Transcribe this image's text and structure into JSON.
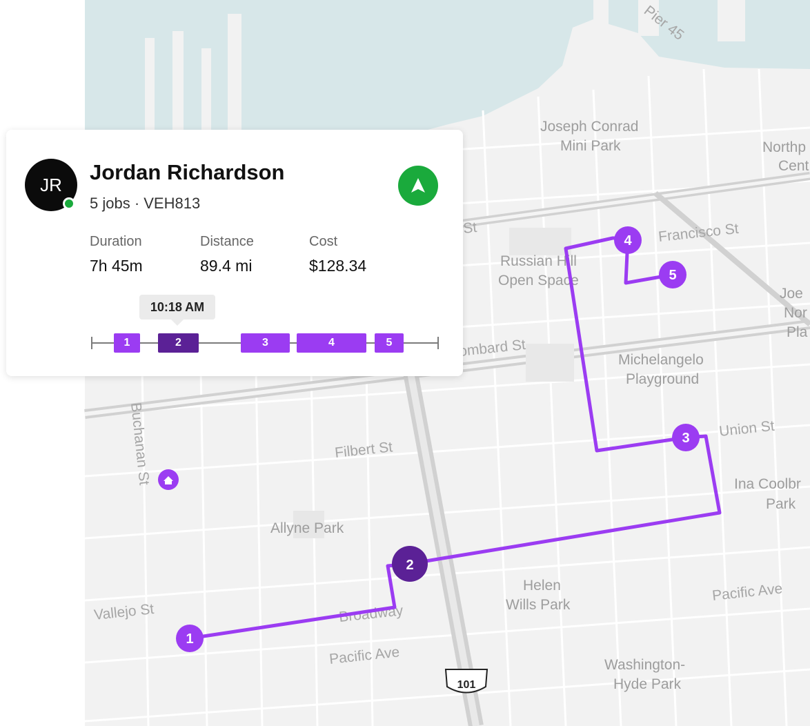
{
  "map": {
    "labels": {
      "pier": "Pier 45",
      "joseph_conrad_1": "Joseph Conrad",
      "joseph_conrad_2": "Mini Park",
      "north_1": "Northp",
      "north_2": "Cent",
      "francisco_st": "Francisco St",
      "st_fragment": "St",
      "russian_hill_1": "Russian Hill",
      "russian_hill_2": "Open Space",
      "joe_1": "Joe",
      "joe_2": "Nor",
      "joe_3": "Pla",
      "lombard_st": "ombard St",
      "michelangelo_1": "Michelangelo",
      "michelangelo_2": "Playground",
      "union_st": "Union St",
      "ina_1": "Ina Coolbr",
      "ina_2": "Park",
      "buchanan_st": "Buchanan St",
      "filbert_st": "Filbert St",
      "allyne_park": "Allyne Park",
      "helen_wills_1": "Helen",
      "helen_wills_2": "Wills Park",
      "pacific_ave_right": "Pacific Ave",
      "vallejo_st": "Vallejo St",
      "broadway": "Broadway",
      "pacific_ave_left": "Pacific Ave",
      "washington_1": "Washington-",
      "washington_2": "Hyde Park",
      "highway": "101"
    },
    "home_icon": "home-icon",
    "stops": [
      "1",
      "2",
      "3",
      "4",
      "5"
    ],
    "active_stop": "2",
    "colors": {
      "route": "#9b3cf2",
      "active_stop": "#5b2196",
      "water": "#d7e7e9",
      "land": "#f2f2f2",
      "road": "#ffffff",
      "highway": "#d1d1d1"
    }
  },
  "card": {
    "avatar_initials": "JR",
    "name": "Jordan Richardson",
    "subtitle": "5 jobs · VEH813",
    "nav_icon": "navigation-arrow-icon",
    "stats": {
      "duration_label": "Duration",
      "duration_value": "7h 45m",
      "distance_label": "Distance",
      "distance_value": "89.4 mi",
      "cost_label": "Cost",
      "cost_value": "$128.34"
    },
    "tooltip": "10:18 AM",
    "timeline": [
      "1",
      "2",
      "3",
      "4",
      "5"
    ],
    "active_segment": "2",
    "colors": {
      "status": "#1aaa3c",
      "nav_button": "#1aaa3c",
      "segment": "#9b3cf2",
      "segment_active": "#5b2196"
    }
  }
}
